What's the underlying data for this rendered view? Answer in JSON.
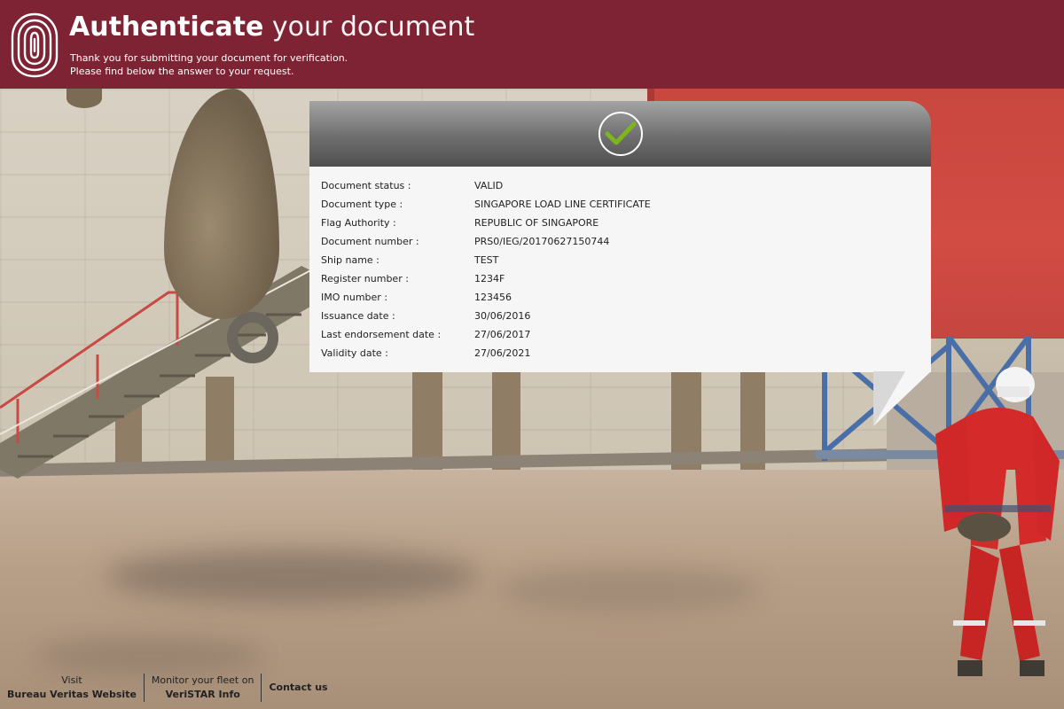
{
  "header": {
    "title_strong": "Authenticate",
    "title_light": "your document",
    "subtitle_line1": "Thank you for submitting your document for verification.",
    "subtitle_line2": "Please find below the answer to your request.",
    "logo_icon": "fingerprint-icon",
    "bg_color": "#7e2333"
  },
  "result": {
    "status_icon": "checkmark-icon",
    "check_color": "#7db51c",
    "fields": [
      {
        "label": "Document status :",
        "value": "VALID"
      },
      {
        "label": "Document type :",
        "value": "SINGAPORE LOAD LINE CERTIFICATE"
      },
      {
        "label": "Flag Authority :",
        "value": "REPUBLIC OF SINGAPORE"
      },
      {
        "label": "Document number :",
        "value": "PRS0/IEG/20170627150744"
      },
      {
        "label": "Ship name :",
        "value": "TEST"
      },
      {
        "label": "Register number :",
        "value": "1234F"
      },
      {
        "label": "IMO number :",
        "value": "123456"
      },
      {
        "label": "Issuance date :",
        "value": "30/06/2016"
      },
      {
        "label": "Last endorsement date :",
        "value": "27/06/2017"
      },
      {
        "label": "Validity date :",
        "value": "27/06/2021"
      }
    ]
  },
  "footer": {
    "visit_pre": "Visit",
    "visit_link": "Bureau Veritas Website",
    "monitor_pre": "Monitor your fleet on",
    "monitor_link": "VeriSTAR Info",
    "contact": "Contact us"
  }
}
